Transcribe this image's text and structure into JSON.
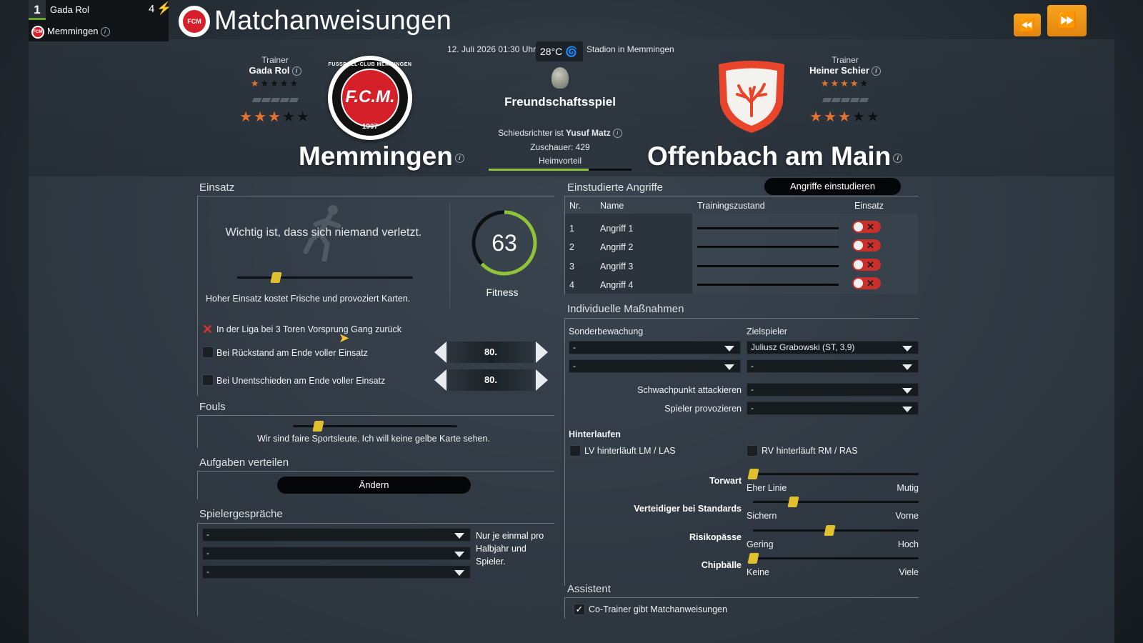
{
  "manager": {
    "rank": "1",
    "name": "Gada Rol",
    "points": "4",
    "club": "Memmingen"
  },
  "page_title": "Matchanweisungen",
  "nav": {
    "back_icon": "rewind-icon",
    "forward_icon": "fast-forward-icon"
  },
  "match": {
    "date": "12. Juli 2026 01:30 Uhr",
    "temperature": "28°C",
    "stadium": "Stadion in Memmingen",
    "type": "Freundschaftsspiel",
    "referee_prefix": "Schiedsrichter ist",
    "referee": "Yusuf Matz",
    "spectators": "Zuschauer: 429",
    "home_advantage": "Heimvorteil",
    "home_advantage_level": 0.7
  },
  "home": {
    "trainer_label": "Trainer",
    "trainer": "Gada Rol",
    "trainer_stars": 1,
    "team_stars": 3,
    "name": "Memmingen",
    "logo_initials": "F.C.M.",
    "logo_arc": "FUSSBALL-CLUB MEMMINGEN",
    "logo_year": "1907"
  },
  "away": {
    "trainer_label": "Trainer",
    "trainer": "Heiner Schier",
    "trainer_stars": 4,
    "team_stars": 3,
    "name": "Offenbach am Main"
  },
  "einsatz": {
    "title": "Einsatz",
    "quote": "Wichtig ist, dass sich niemand verletzt.",
    "slider_level": 0.22,
    "hint": "Hoher Einsatz kostet Frische und provoziert Karten.",
    "fitness_value": "63",
    "fitness_fraction": 0.63,
    "fitness_label": "Fitness",
    "rule1": "In der Liga bei 3 Toren Vorsprung Gang zurück",
    "rule2": "Bei Rückstand am Ende voller Einsatz",
    "rule2_value": "80.",
    "rule3": "Bei Unentschieden am Ende voller Einsatz",
    "rule3_value": "80."
  },
  "fouls": {
    "title": "Fouls",
    "slider_level": 0.15,
    "quote": "Wir sind faire Sportsleute. Ich will keine gelbe Karte sehen."
  },
  "aufgaben": {
    "title": "Aufgaben verteilen",
    "button": "Ändern"
  },
  "gespraeche": {
    "title": "Spielergespräche",
    "selects": [
      "-",
      "-",
      "-"
    ],
    "note": "Nur je einmal pro Halbjahr und Spieler."
  },
  "angriffe": {
    "title": "Einstudierte Angriffe",
    "button": "Angriffe einstudieren",
    "headers": {
      "nr": "Nr.",
      "name": "Name",
      "training": "Trainingszustand",
      "einsatz": "Einsatz"
    },
    "rows": [
      {
        "nr": "1",
        "name": "Angriff 1"
      },
      {
        "nr": "2",
        "name": "Angriff 2"
      },
      {
        "nr": "3",
        "name": "Angriff 3"
      },
      {
        "nr": "4",
        "name": "Angriff 4"
      }
    ]
  },
  "massnahmen": {
    "title": "Individuelle Maßnahmen",
    "sonderbewachung_label": "Sonderbewachung",
    "zielspieler_label": "Zielspieler",
    "sb1": "-",
    "sb2": "-",
    "zs1": "Juliusz Grabowski (ST, 3,9)",
    "zs2": "-",
    "schwachpunkt_label": "Schwachpunkt attackieren",
    "schwachpunkt": "-",
    "provozieren_label": "Spieler provozieren",
    "provozieren": "-"
  },
  "hinterlaufen": {
    "title": "Hinterlaufen",
    "lv": "LV hinterläuft LM / LAS",
    "rv": "RV hinterläuft RM / RAS"
  },
  "sliders": [
    {
      "label": "Torwart",
      "left": "Eher Linie",
      "right": "Mutig",
      "level": 0.0
    },
    {
      "label": "Verteidiger bei Standards",
      "left": "Sichern",
      "right": "Vorne",
      "level": 0.24
    },
    {
      "label": "Risikopässe",
      "left": "Gering",
      "right": "Hoch",
      "level": 0.46
    },
    {
      "label": "Chipbälle",
      "left": "Keine",
      "right": "Viele",
      "level": 0.0
    }
  ],
  "assistent": {
    "title": "Assistent",
    "checkbox": "Co-Trainer gibt Matchanweisungen",
    "checked": true
  },
  "colors": {
    "accent_orange": "#f29a1b",
    "fitness_green": "#8fc33a",
    "toggle_red": "#c9302c",
    "slider_yellow": "#e0c02f"
  }
}
